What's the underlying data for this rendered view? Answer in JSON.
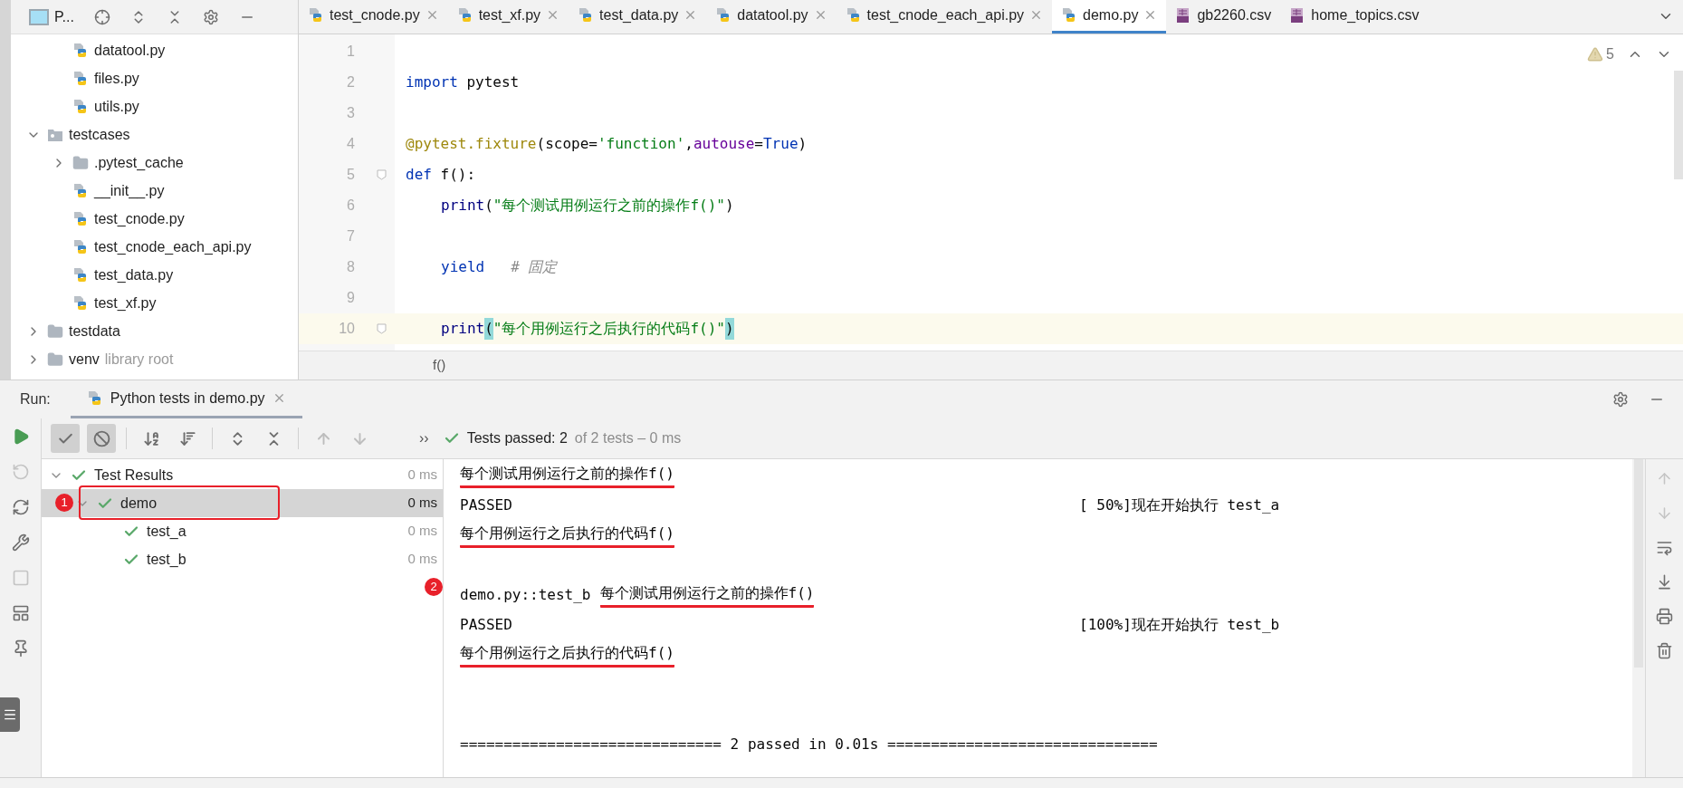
{
  "project_panel": {
    "title": "P...",
    "tree": [
      {
        "children": [
          {
            "label": "datatool.py",
            "kind": "py"
          },
          {
            "label": "files.py",
            "kind": "py"
          },
          {
            "label": "utils.py",
            "kind": "py"
          }
        ]
      },
      {
        "label": "testcases",
        "kind": "package",
        "expanded": true,
        "children": [
          {
            "label": ".pytest_cache",
            "kind": "folder",
            "expanded": false
          },
          {
            "label": "__init__.py",
            "kind": "py"
          },
          {
            "label": "test_cnode.py",
            "kind": "py"
          },
          {
            "label": "test_cnode_each_api.py",
            "kind": "py"
          },
          {
            "label": "test_data.py",
            "kind": "py"
          },
          {
            "label": "test_xf.py",
            "kind": "py"
          }
        ]
      },
      {
        "label": "testdata",
        "kind": "folder",
        "expanded": false
      },
      {
        "label": "venv",
        "note": "library root",
        "kind": "folder",
        "expanded": false
      }
    ]
  },
  "editor_tabs": [
    {
      "label": "test_cnode.py",
      "kind": "py",
      "selected": false,
      "closable": true
    },
    {
      "label": "test_xf.py",
      "kind": "py",
      "selected": false,
      "closable": true
    },
    {
      "label": "test_data.py",
      "kind": "py",
      "selected": false,
      "closable": true
    },
    {
      "label": "datatool.py",
      "kind": "py",
      "selected": false,
      "closable": true
    },
    {
      "label": "test_cnode_each_api.py",
      "kind": "py",
      "selected": false,
      "closable": true
    },
    {
      "label": "demo.py",
      "kind": "py",
      "selected": true,
      "closable": true
    },
    {
      "label": "gb2260.csv",
      "kind": "csv",
      "selected": false,
      "closable": false
    },
    {
      "label": "home_topics.csv",
      "kind": "csv",
      "selected": false,
      "closable": false
    }
  ],
  "editor": {
    "warnings": "5",
    "lines": [
      {
        "number": "1",
        "current": false,
        "fold": false
      },
      {
        "number": "2",
        "current": false,
        "fold": false,
        "indented": false,
        "tokens": [
          {
            "text": "import",
            "kind": "keyword"
          },
          {
            "text": " pytest",
            "kind": "plain"
          }
        ]
      },
      {
        "number": "3",
        "current": false,
        "fold": false
      },
      {
        "number": "4",
        "current": false,
        "fold": false,
        "indented": false,
        "tokens": [
          {
            "text": "@pytest.fixture",
            "kind": "decorator"
          },
          {
            "text": "(scope=",
            "kind": "plain"
          },
          {
            "text": "'function'",
            "kind": "string"
          },
          {
            "text": ",",
            "kind": "plain"
          },
          {
            "text": "autouse",
            "kind": "param"
          },
          {
            "text": "=",
            "kind": "plain"
          },
          {
            "text": "True",
            "kind": "keyword"
          },
          {
            "text": ")",
            "kind": "plain"
          }
        ]
      },
      {
        "number": "5",
        "current": false,
        "fold": true,
        "indented": false,
        "tokens": [
          {
            "text": "def",
            "kind": "keyword"
          },
          {
            "text": " f():",
            "kind": "plain"
          }
        ]
      },
      {
        "number": "6",
        "current": false,
        "fold": false,
        "indented": true,
        "tokens": [
          {
            "text": "print",
            "kind": "builtin"
          },
          {
            "text": "(",
            "kind": "plain"
          },
          {
            "text": "\"每个测试用例运行之前的操作f()\"",
            "kind": "string"
          },
          {
            "text": ")",
            "kind": "plain"
          }
        ]
      },
      {
        "number": "7",
        "current": false,
        "fold": false
      },
      {
        "number": "8",
        "current": false,
        "fold": false,
        "indented": true,
        "tokens": [
          {
            "text": "yield",
            "kind": "keyword"
          },
          {
            "text": "# 固定",
            "kind": "comment"
          }
        ]
      },
      {
        "number": "9",
        "current": false,
        "fold": false
      },
      {
        "number": "10",
        "current": true,
        "fold": true,
        "indented": true,
        "tokens": [
          {
            "text": "print",
            "kind": "builtin"
          },
          {
            "text": "(",
            "kind": "bracket"
          },
          {
            "text": "\"每个用例运行之后执行的代码f()\"",
            "kind": "string"
          },
          {
            "text": ")",
            "kind": "bracket"
          }
        ]
      }
    ],
    "breadcrumb": "f()"
  },
  "run_panel": {
    "label": "Run:",
    "tab": "Python tests in demo.py",
    "toolbar": [
      {
        "kind": "show-passed",
        "selected": true
      },
      {
        "kind": "show-ignored",
        "selected": true
      },
      {
        "kind": "sort-alpha",
        "selected": false
      },
      {
        "kind": "sort-duration",
        "selected": false
      },
      {
        "kind": "expand",
        "selected": false
      },
      {
        "kind": "collapse",
        "selected": false
      },
      {
        "kind": "previous",
        "selected": false
      },
      {
        "kind": "next",
        "selected": false
      }
    ],
    "more": "››",
    "status": {
      "passed": "Tests passed: 2",
      "detail": "of 2 tests – 0 ms"
    },
    "side_tools": [
      {
        "kind": "rerun",
        "disabled": false
      },
      {
        "kind": "rerun-failed",
        "disabled": true
      },
      {
        "kind": "auto-test",
        "disabled": false
      },
      {
        "kind": "settings",
        "disabled": false
      },
      {
        "kind": "stop",
        "disabled": true
      },
      {
        "kind": "layout",
        "disabled": false
      },
      {
        "kind": "pin",
        "disabled": false
      }
    ],
    "results": [
      {
        "label": "Test Results",
        "time": "0 ms",
        "selected": false,
        "expanded": true,
        "children": [
          {
            "label": "demo",
            "time": "0 ms",
            "selected": true,
            "expanded": true,
            "children": [
              {
                "label": "test_a",
                "time": "0 ms",
                "selected": false
              },
              {
                "label": "test_b",
                "time": "0 ms",
                "selected": false
              }
            ]
          }
        ]
      }
    ],
    "console": [
      {
        "kind": "text",
        "segments": [
          {
            "text": "每个测试用例运行之前的操作f()",
            "underlined": true
          }
        ]
      },
      {
        "kind": "text",
        "segments": [
          {
            "text": "PASSED",
            "underlined": false
          }
        ],
        "right": "[ 50%]现在开始执行 test_a"
      },
      {
        "kind": "text",
        "segments": [
          {
            "text": "每个用例运行之后执行的代码f()",
            "underlined": true
          }
        ]
      },
      {
        "kind": "blank"
      },
      {
        "kind": "text",
        "segments": [
          {
            "text": "demo.py::test_b",
            "underlined": false
          },
          {
            "text": "每个测试用例运行之前的操作f()",
            "underlined": true
          }
        ]
      },
      {
        "kind": "text",
        "segments": [
          {
            "text": "PASSED",
            "underlined": false
          }
        ],
        "right": "[100%]现在开始执行 test_b"
      },
      {
        "kind": "text",
        "segments": [
          {
            "text": "每个用例运行之后执行的代码f()",
            "underlined": true
          }
        ]
      },
      {
        "kind": "blank"
      },
      {
        "kind": "blank"
      },
      {
        "kind": "text",
        "segments": [
          {
            "text": "============================== 2 passed in 0.01s ===============================",
            "underlined": false
          }
        ]
      }
    ],
    "console_tools": [
      {
        "kind": "up"
      },
      {
        "kind": "down"
      },
      {
        "kind": "wrap"
      },
      {
        "kind": "scroll-end"
      },
      {
        "kind": "print"
      },
      {
        "kind": "delete"
      }
    ],
    "annotations": [
      {
        "label": "1"
      },
      {
        "label": "2"
      }
    ]
  }
}
